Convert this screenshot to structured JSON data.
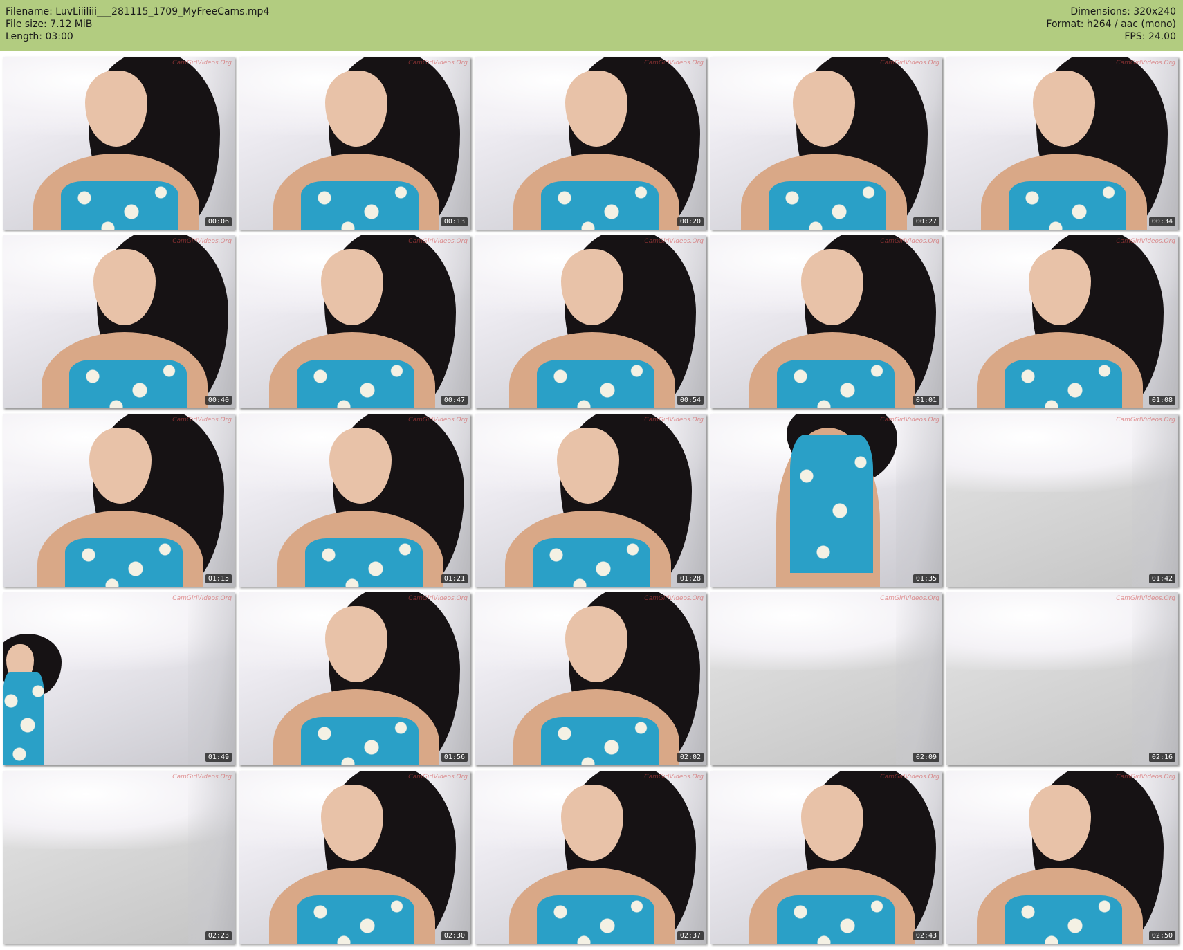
{
  "header": {
    "filename_label": "Filename: LuvLiiiliii___281115_1709_MyFreeCams.mp4",
    "filesize_label": "File size: 7.12 MiB",
    "length_label": "Length: 03:00",
    "dimensions_label": "Dimensions: 320x240",
    "format_label": "Format: h264 / aac (mono)",
    "fps_label": "FPS: 24.00",
    "background_color": "#b2cc80"
  },
  "watermark": "CamGirlVideos.Org",
  "thumbnails": [
    {
      "timestamp": "00:06",
      "scene": "person"
    },
    {
      "timestamp": "00:13",
      "scene": "person"
    },
    {
      "timestamp": "00:20",
      "scene": "person"
    },
    {
      "timestamp": "00:27",
      "scene": "person"
    },
    {
      "timestamp": "00:34",
      "scene": "person"
    },
    {
      "timestamp": "00:40",
      "scene": "person"
    },
    {
      "timestamp": "00:47",
      "scene": "person"
    },
    {
      "timestamp": "00:54",
      "scene": "person"
    },
    {
      "timestamp": "01:01",
      "scene": "person"
    },
    {
      "timestamp": "01:08",
      "scene": "person"
    },
    {
      "timestamp": "01:15",
      "scene": "person"
    },
    {
      "timestamp": "01:21",
      "scene": "person"
    },
    {
      "timestamp": "01:28",
      "scene": "person"
    },
    {
      "timestamp": "01:35",
      "scene": "person-standing"
    },
    {
      "timestamp": "01:42",
      "scene": "empty-room"
    },
    {
      "timestamp": "01:49",
      "scene": "person-edge"
    },
    {
      "timestamp": "01:56",
      "scene": "person"
    },
    {
      "timestamp": "02:02",
      "scene": "person"
    },
    {
      "timestamp": "02:09",
      "scene": "empty-room"
    },
    {
      "timestamp": "02:16",
      "scene": "empty-room"
    },
    {
      "timestamp": "02:23",
      "scene": "empty-room"
    },
    {
      "timestamp": "02:30",
      "scene": "person"
    },
    {
      "timestamp": "02:37",
      "scene": "person"
    },
    {
      "timestamp": "02:43",
      "scene": "person"
    },
    {
      "timestamp": "02:50",
      "scene": "person"
    }
  ]
}
